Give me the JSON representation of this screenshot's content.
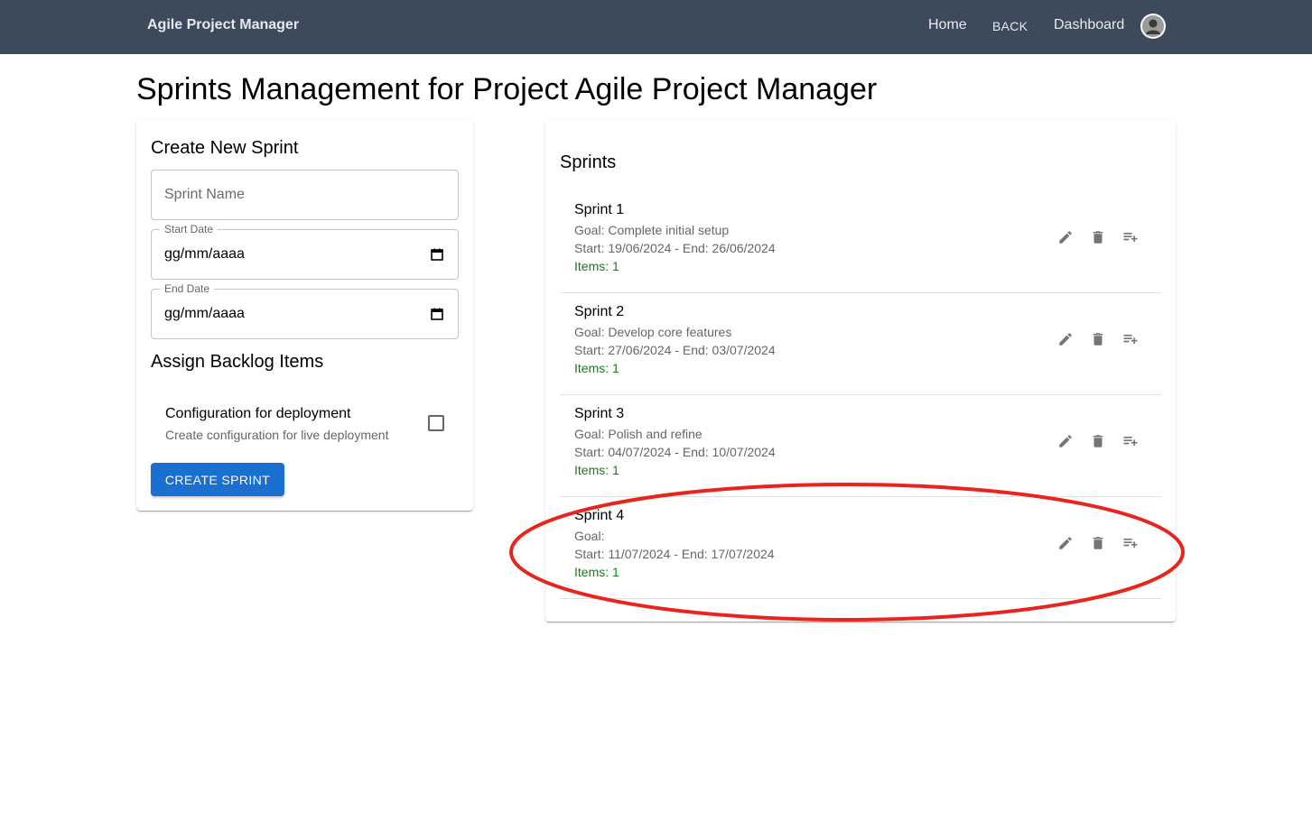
{
  "navbar": {
    "brand": "Agile Project Manager",
    "links": {
      "home": "Home",
      "back": "BACK",
      "dashboard": "Dashboard"
    },
    "avatar_icon": "user-avatar-icon",
    "background": "#3d4a5c"
  },
  "page": {
    "title": "Sprints Management for Project Agile Project Manager"
  },
  "create_form": {
    "heading": "Create New Sprint",
    "sprint_name_placeholder": "Sprint Name",
    "start_date_label": "Start Date",
    "start_date_value": "gg/mm/aaaa",
    "end_date_label": "End Date",
    "end_date_value": "gg/mm/aaaa",
    "assign_heading": "Assign Backlog Items",
    "backlog_items": [
      {
        "title": "Configuration for deployment",
        "description": "Create configuration for live deployment",
        "checked": false
      }
    ],
    "submit_label": "CREATE SPRINT",
    "accent": "#1a6fd0"
  },
  "sprint_list": {
    "heading": "Sprints",
    "sprints": [
      {
        "name": "Sprint 1",
        "goal": "Goal: Complete initial setup",
        "dates": "Start: 19/06/2024 - End: 26/06/2024",
        "items": "Items: 1"
      },
      {
        "name": "Sprint 2",
        "goal": "Goal: Develop core features",
        "dates": "Start: 27/06/2024 - End: 03/07/2024",
        "items": "Items: 1"
      },
      {
        "name": "Sprint 3",
        "goal": "Goal: Polish and refine",
        "dates": "Start: 04/07/2024 - End: 10/07/2024",
        "items": "Items: 1"
      },
      {
        "name": "Sprint 4",
        "goal": "Goal:",
        "dates": "Start: 11/07/2024 - End: 17/07/2024",
        "items": "Items: 1"
      }
    ],
    "actions": [
      "edit-icon",
      "delete-icon",
      "playlist-add-icon"
    ],
    "items_color": "#1a7a1a"
  },
  "annotation": {
    "shape": "ellipse",
    "color": "#e8251c",
    "highlights": "Sprint 4"
  }
}
